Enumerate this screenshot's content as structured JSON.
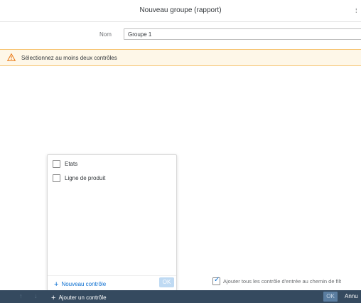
{
  "header": {
    "title": "Nouveau groupe (rapport)"
  },
  "form": {
    "name_label": "Nom",
    "name_value": "Groupe 1"
  },
  "warning": {
    "text": "Sélectionnez au moins deux contrôles"
  },
  "popover": {
    "items": [
      {
        "label": "Etats",
        "checked": false
      },
      {
        "label": "Ligne de produit",
        "checked": false
      }
    ],
    "new_control_label": "Nouveau contrôle",
    "ok_label": "OK"
  },
  "add_to_path": {
    "label": "Ajouter tous les contrôle d'entrée au chemin de filt",
    "checked": true
  },
  "footer": {
    "add_control_label": "Ajouter un contrôle",
    "ok_label": "OK",
    "cancel_label": "Annu"
  },
  "colors": {
    "accent": "#0a6ed1",
    "footer_bg": "#354a5f",
    "warning_bg": "#fef7e8",
    "warning_border": "#f6c26e"
  }
}
